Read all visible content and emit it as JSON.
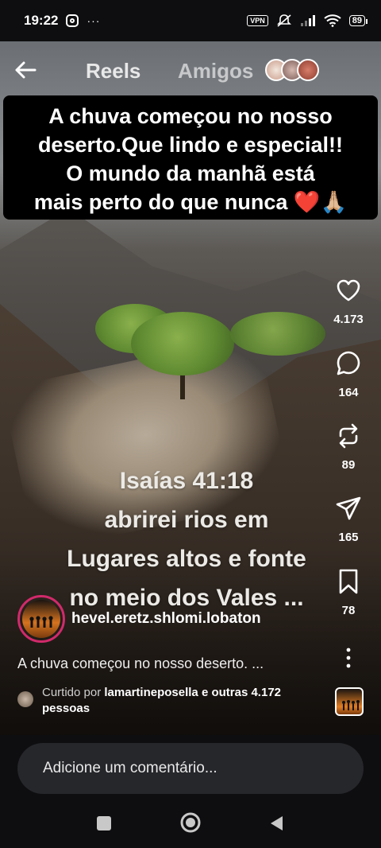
{
  "status_bar": {
    "time": "19:22",
    "more": "···",
    "vpn": "VPN",
    "battery": "89"
  },
  "header": {
    "back_icon": "arrow-left-icon",
    "tabs": [
      {
        "label": "Reels",
        "active": true
      },
      {
        "label": "Amigos",
        "active": false
      }
    ]
  },
  "caption_overlay": {
    "lines": [
      "A chuva começou no nosso",
      "deserto.Que lindo e especial!!",
      "O mundo da manhã está",
      "mais perto do que nunca ❤️🙏🏼"
    ]
  },
  "verse_overlay": {
    "lines": [
      "Isaías 41:18",
      "abrirei rios em",
      "Lugares altos e fonte",
      "no meio dos Vales ..."
    ]
  },
  "actions": {
    "likes": "4.173",
    "comments": "164",
    "reposts": "89",
    "shares": "165",
    "saves": "78"
  },
  "post": {
    "username": "hevel.eretz.shlomi.lobaton",
    "description": "A chuva começou no nosso deserto. ...",
    "liked_prefix": "Curtido por",
    "liked_user": "lamartineposella",
    "liked_suffix": "e outras",
    "liked_count": "4.172",
    "liked_tail": "pessoas"
  },
  "comment_input": {
    "placeholder": "Adicione um comentário..."
  },
  "colors": {
    "story_ring": "#d12a6b",
    "background": "#0e0e10",
    "heart": "#e0202a"
  }
}
